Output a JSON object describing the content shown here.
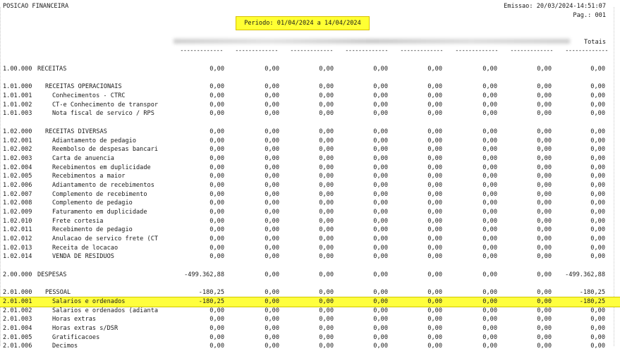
{
  "header": {
    "title": "POSICAO FINANCEIRA",
    "emissao": "Emissao: 20/03/2024-14:51:07",
    "pagina": "Pag.: 001",
    "periodo": "Periodo: 01/04/2024 a 14/04/2024",
    "totais_label": "Totais",
    "dash": "-------------"
  },
  "rows": [
    {
      "code": "1.00.000",
      "desc": "RECEITAS",
      "level": 0,
      "values": [
        "0,00",
        "0,00",
        "0,00",
        "0,00",
        "0,00",
        "0,00",
        "0,00",
        "0,00"
      ]
    },
    {
      "gap": true
    },
    {
      "code": "1.01.000",
      "desc": "RECEITAS OPERACIONAIS",
      "level": 1,
      "values": [
        "0,00",
        "0,00",
        "0,00",
        "0,00",
        "0,00",
        "0,00",
        "0,00",
        "0,00"
      ]
    },
    {
      "code": "1.01.001",
      "desc": "Conhecimentos - CTRC",
      "level": 2,
      "values": [
        "0,00",
        "0,00",
        "0,00",
        "0,00",
        "0,00",
        "0,00",
        "0,00",
        "0,00"
      ]
    },
    {
      "code": "1.01.002",
      "desc": "CT-e Conhecimento de transpor",
      "level": 2,
      "values": [
        "0,00",
        "0,00",
        "0,00",
        "0,00",
        "0,00",
        "0,00",
        "0,00",
        "0,00"
      ]
    },
    {
      "code": "1.01.003",
      "desc": "Nota fiscal de servico / RPS",
      "level": 2,
      "values": [
        "0,00",
        "0,00",
        "0,00",
        "0,00",
        "0,00",
        "0,00",
        "0,00",
        "0,00"
      ]
    },
    {
      "gap": true
    },
    {
      "code": "1.02.000",
      "desc": "RECEITAS DIVERSAS",
      "level": 1,
      "values": [
        "0,00",
        "0,00",
        "0,00",
        "0,00",
        "0,00",
        "0,00",
        "0,00",
        "0,00"
      ]
    },
    {
      "code": "1.02.001",
      "desc": "Adiantamento de pedagio",
      "level": 2,
      "values": [
        "0,00",
        "0,00",
        "0,00",
        "0,00",
        "0,00",
        "0,00",
        "0,00",
        "0,00"
      ]
    },
    {
      "code": "1.02.002",
      "desc": "Reembolso de despesas bancari",
      "level": 2,
      "values": [
        "0,00",
        "0,00",
        "0,00",
        "0,00",
        "0,00",
        "0,00",
        "0,00",
        "0,00"
      ]
    },
    {
      "code": "1.02.003",
      "desc": "Carta de anuencia",
      "level": 2,
      "values": [
        "0,00",
        "0,00",
        "0,00",
        "0,00",
        "0,00",
        "0,00",
        "0,00",
        "0,00"
      ]
    },
    {
      "code": "1.02.004",
      "desc": "Recebimentos em duplicidade",
      "level": 2,
      "values": [
        "0,00",
        "0,00",
        "0,00",
        "0,00",
        "0,00",
        "0,00",
        "0,00",
        "0,00"
      ]
    },
    {
      "code": "1.02.005",
      "desc": "Recebimentos a maior",
      "level": 2,
      "values": [
        "0,00",
        "0,00",
        "0,00",
        "0,00",
        "0,00",
        "0,00",
        "0,00",
        "0,00"
      ]
    },
    {
      "code": "1.02.006",
      "desc": "Adiantamento de recebimentos",
      "level": 2,
      "values": [
        "0,00",
        "0,00",
        "0,00",
        "0,00",
        "0,00",
        "0,00",
        "0,00",
        "0,00"
      ]
    },
    {
      "code": "1.02.007",
      "desc": "Complemento de recebimento",
      "level": 2,
      "values": [
        "0,00",
        "0,00",
        "0,00",
        "0,00",
        "0,00",
        "0,00",
        "0,00",
        "0,00"
      ]
    },
    {
      "code": "1.02.008",
      "desc": "Complemento de pedagio",
      "level": 2,
      "values": [
        "0,00",
        "0,00",
        "0,00",
        "0,00",
        "0,00",
        "0,00",
        "0,00",
        "0,00"
      ]
    },
    {
      "code": "1.02.009",
      "desc": "Faturamento em duplicidade",
      "level": 2,
      "values": [
        "0,00",
        "0,00",
        "0,00",
        "0,00",
        "0,00",
        "0,00",
        "0,00",
        "0,00"
      ]
    },
    {
      "code": "1.02.010",
      "desc": "Frete cortesia",
      "level": 2,
      "values": [
        "0,00",
        "0,00",
        "0,00",
        "0,00",
        "0,00",
        "0,00",
        "0,00",
        "0,00"
      ]
    },
    {
      "code": "1.02.011",
      "desc": "Recebimento de pedagio",
      "level": 2,
      "values": [
        "0,00",
        "0,00",
        "0,00",
        "0,00",
        "0,00",
        "0,00",
        "0,00",
        "0,00"
      ]
    },
    {
      "code": "1.02.012",
      "desc": "Anulacao de servico frete (CT",
      "level": 2,
      "values": [
        "0,00",
        "0,00",
        "0,00",
        "0,00",
        "0,00",
        "0,00",
        "0,00",
        "0,00"
      ]
    },
    {
      "code": "1.02.013",
      "desc": "Receita de locacao",
      "level": 2,
      "values": [
        "0,00",
        "0,00",
        "0,00",
        "0,00",
        "0,00",
        "0,00",
        "0,00",
        "0,00"
      ]
    },
    {
      "code": "1.02.014",
      "desc": "VENDA DE RESIDUOS",
      "level": 2,
      "values": [
        "0,00",
        "0,00",
        "0,00",
        "0,00",
        "0,00",
        "0,00",
        "0,00",
        "0,00"
      ]
    },
    {
      "gap": true
    },
    {
      "code": "2.00.000",
      "desc": "DESPESAS",
      "level": 0,
      "values": [
        "-499.362,88",
        "0,00",
        "0,00",
        "0,00",
        "0,00",
        "0,00",
        "0,00",
        "-499.362,88"
      ]
    },
    {
      "gap": true
    },
    {
      "code": "2.01.000",
      "desc": "PESSOAL",
      "level": 1,
      "values": [
        "-180,25",
        "0,00",
        "0,00",
        "0,00",
        "0,00",
        "0,00",
        "0,00",
        "-180,25"
      ]
    },
    {
      "code": "2.01.001",
      "desc": "Salarios e ordenados",
      "level": 2,
      "highlight": true,
      "values": [
        "-180,25",
        "0,00",
        "0,00",
        "0,00",
        "0,00",
        "0,00",
        "0,00",
        "-180,25"
      ]
    },
    {
      "code": "2.01.002",
      "desc": "Salarios e ordenados (adianta",
      "level": 2,
      "values": [
        "0,00",
        "0,00",
        "0,00",
        "0,00",
        "0,00",
        "0,00",
        "0,00",
        "0,00"
      ]
    },
    {
      "code": "2.01.003",
      "desc": "Horas extras",
      "level": 2,
      "values": [
        "0,00",
        "0,00",
        "0,00",
        "0,00",
        "0,00",
        "0,00",
        "0,00",
        "0,00"
      ]
    },
    {
      "code": "2.01.004",
      "desc": "Horas extras s/DSR",
      "level": 2,
      "values": [
        "0,00",
        "0,00",
        "0,00",
        "0,00",
        "0,00",
        "0,00",
        "0,00",
        "0,00"
      ]
    },
    {
      "code": "2.01.005",
      "desc": "Gratificacoes",
      "level": 2,
      "values": [
        "0,00",
        "0,00",
        "0,00",
        "0,00",
        "0,00",
        "0,00",
        "0,00",
        "0,00"
      ]
    },
    {
      "code": "2.01.006",
      "desc": "Decimos",
      "level": 2,
      "values": [
        "0,00",
        "0,00",
        "0,00",
        "0,00",
        "0,00",
        "0,00",
        "0,00",
        "0,00"
      ]
    }
  ]
}
